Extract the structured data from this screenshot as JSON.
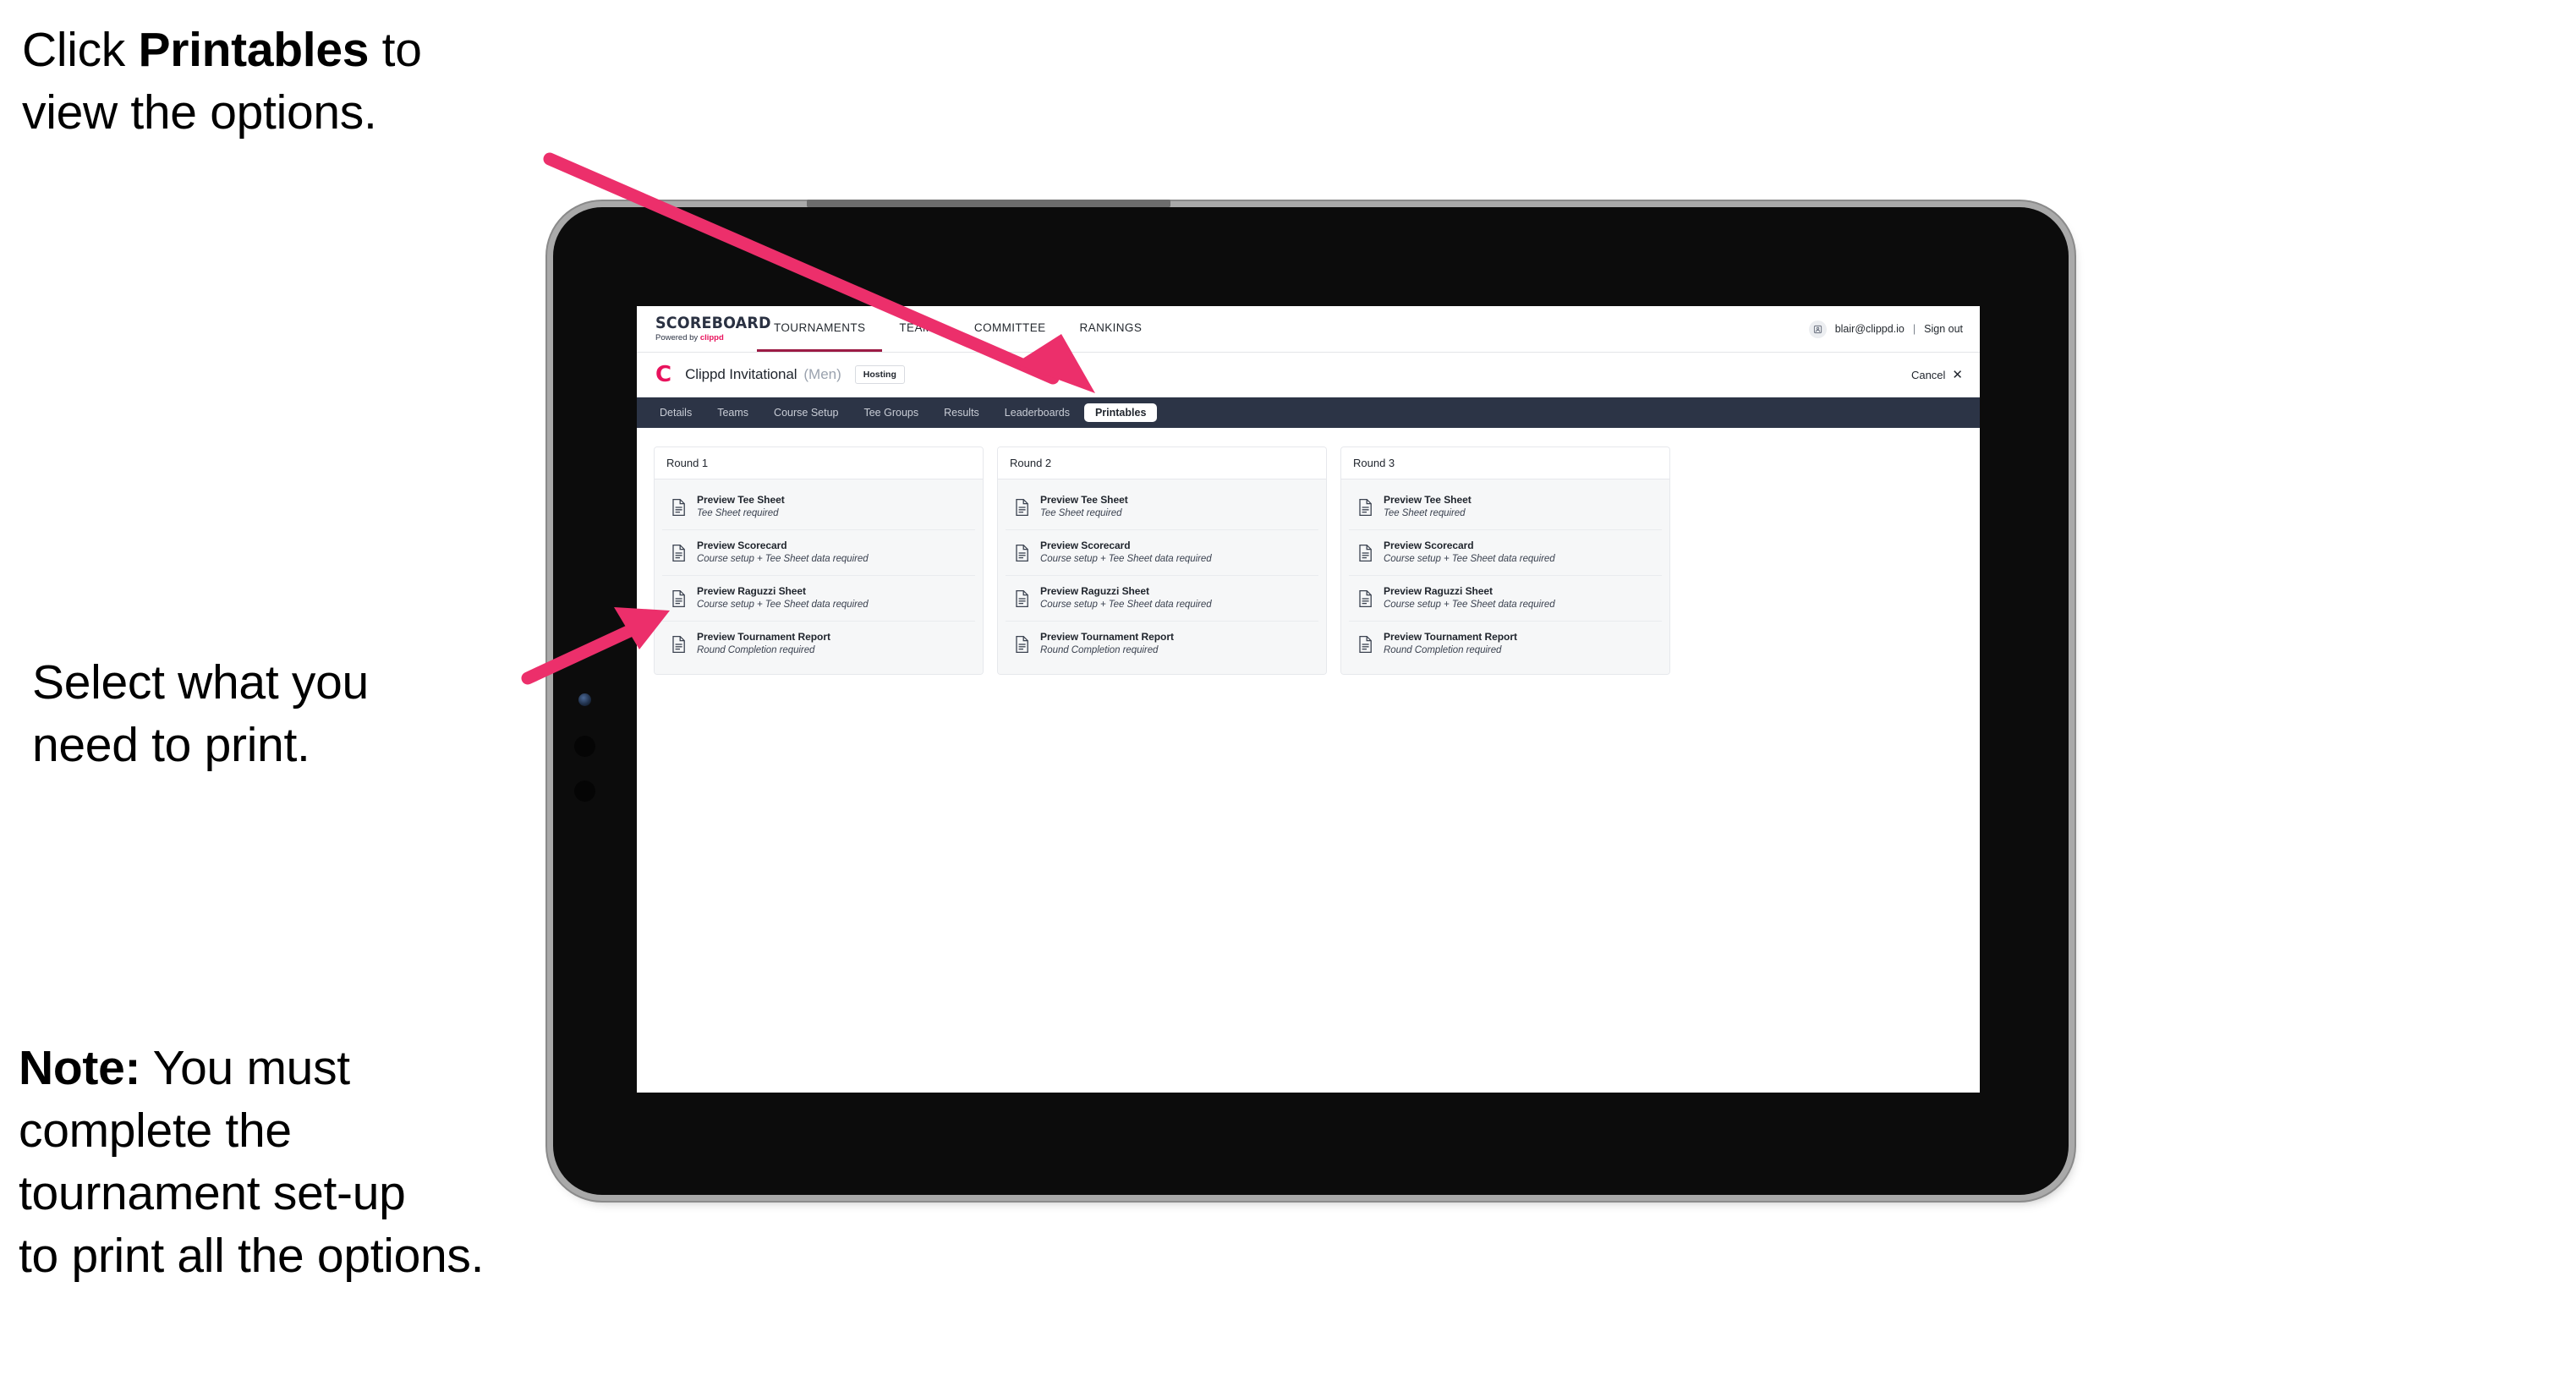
{
  "annotations": [
    {
      "id": "annot-1",
      "prefix": "Click ",
      "bold": "Printables",
      "suffix": " to\nview the options."
    },
    {
      "id": "annot-2",
      "text": "Select what you\n need to print."
    },
    {
      "id": "annot-3",
      "prefix": "",
      "bold": "Note:",
      "suffix": " You must\ncomplete the\ntournament set-up\nto print all the options."
    }
  ],
  "accent_colors": {
    "arrow_pink": "#ec2f6b",
    "brand_pink": "#e8125c",
    "tab_bar_navy": "#2c3446",
    "nav_active_underline": "#9c1b45"
  },
  "app": {
    "brand": {
      "title": "SCOREBOARD",
      "powered_prefix": "Powered by ",
      "powered_brand": "clippd"
    },
    "nav": {
      "items": [
        {
          "label": "TOURNAMENTS",
          "active": true
        },
        {
          "label": "TEAMS",
          "active": false
        },
        {
          "label": "COMMITTEE",
          "active": false
        },
        {
          "label": "RANKINGS",
          "active": false
        }
      ],
      "user_email": "blair@clippd.io",
      "separator": "|",
      "sign_out": "Sign out",
      "avatar_icon": "user-avatar-icon"
    },
    "tournament": {
      "logo_letter": "C",
      "name": "Clippd Invitational",
      "gender": "(Men)",
      "badge": "Hosting",
      "cancel_label": "Cancel",
      "cancel_icon": "close-icon"
    },
    "tabs": [
      {
        "label": "Details",
        "active": false
      },
      {
        "label": "Teams",
        "active": false
      },
      {
        "label": "Course Setup",
        "active": false
      },
      {
        "label": "Tee Groups",
        "active": false
      },
      {
        "label": "Results",
        "active": false
      },
      {
        "label": "Leaderboards",
        "active": false
      },
      {
        "label": "Printables",
        "active": true
      }
    ],
    "rounds": [
      {
        "title": "Round 1",
        "items": [
          {
            "title": "Preview Tee Sheet",
            "sub": "Tee Sheet required",
            "icon": "document-icon"
          },
          {
            "title": "Preview Scorecard",
            "sub": "Course setup + Tee Sheet data required",
            "icon": "document-icon"
          },
          {
            "title": "Preview Raguzzi Sheet",
            "sub": "Course setup + Tee Sheet data required",
            "icon": "document-icon"
          },
          {
            "title": "Preview Tournament Report",
            "sub": "Round Completion required",
            "icon": "document-icon"
          }
        ]
      },
      {
        "title": "Round 2",
        "items": [
          {
            "title": "Preview Tee Sheet",
            "sub": "Tee Sheet required",
            "icon": "document-icon"
          },
          {
            "title": "Preview Scorecard",
            "sub": "Course setup + Tee Sheet data required",
            "icon": "document-icon"
          },
          {
            "title": "Preview Raguzzi Sheet",
            "sub": "Course setup + Tee Sheet data required",
            "icon": "document-icon"
          },
          {
            "title": "Preview Tournament Report",
            "sub": "Round Completion required",
            "icon": "document-icon"
          }
        ]
      },
      {
        "title": "Round 3",
        "items": [
          {
            "title": "Preview Tee Sheet",
            "sub": "Tee Sheet required",
            "icon": "document-icon"
          },
          {
            "title": "Preview Scorecard",
            "sub": "Course setup + Tee Sheet data required",
            "icon": "document-icon"
          },
          {
            "title": "Preview Raguzzi Sheet",
            "sub": "Course setup + Tee Sheet data required",
            "icon": "document-icon"
          },
          {
            "title": "Preview Tournament Report",
            "sub": "Round Completion required",
            "icon": "document-icon"
          }
        ]
      }
    ]
  }
}
